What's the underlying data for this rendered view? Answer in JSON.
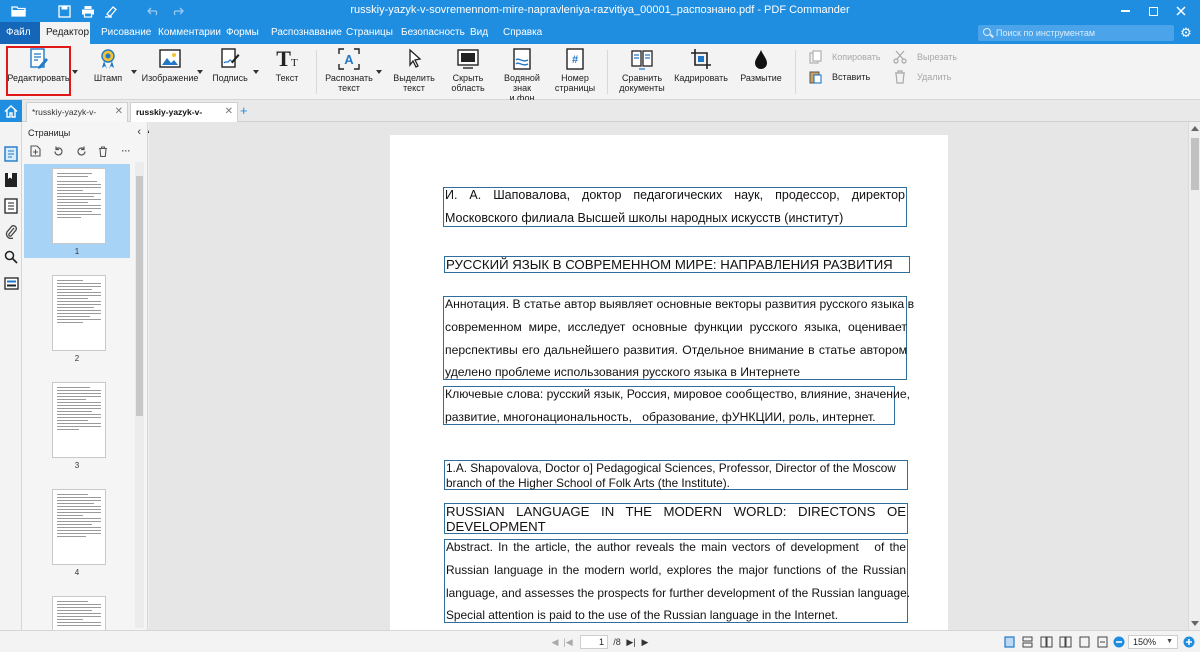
{
  "window": {
    "title": "russkiy-yazyk-v-sovremennom-mire-napravleniya-razvitiya_00001_распознано.pdf - PDF Commander"
  },
  "quick_access": [
    "open-folder-icon",
    "save-icon",
    "print-icon",
    "brush-icon",
    "undo-icon",
    "redo-icon"
  ],
  "menu": {
    "file": "Файл",
    "items": [
      "Редактор",
      "Рисование",
      "Комментарии",
      "Формы",
      "Распознавание",
      "Страницы",
      "Безопасность",
      "Вид",
      "Справка"
    ],
    "active_index": 0,
    "search_placeholder": "Поиск по инструментам"
  },
  "ribbon": {
    "edit": "Редактировать",
    "stamp": "Штамп",
    "image": "Изображение",
    "signature": "Подпись",
    "text": "Текст",
    "recognize_text": [
      "Распознать",
      "текст"
    ],
    "select_text": [
      "Выделить",
      "текст"
    ],
    "hide_area": [
      "Скрыть",
      "область"
    ],
    "watermark": [
      "Водяной знак",
      "и фон"
    ],
    "page_number": [
      "Номер",
      "страницы"
    ],
    "compare": [
      "Сравнить",
      "документы"
    ],
    "crop": "Кадрировать",
    "blur": "Размытие",
    "copy": "Копировать",
    "paste": "Вставить",
    "cut": "Вырезать",
    "delete": "Удалить"
  },
  "tabs": [
    {
      "label": "*russkiy-yazyk-v-sovrem...",
      "active": false
    },
    {
      "label": "russkiy-yazyk-v-sovreme...",
      "active": true
    }
  ],
  "pages_panel": {
    "title": "Страницы",
    "thumbnails": [
      "1",
      "2",
      "3",
      "4"
    ]
  },
  "document": {
    "author_ru": [
      "И.   А.   Шаповалова,   доктор   педагогических   наук,   продессор,   директор",
      "Московского филиала Высшей школы народных искусств (институт)"
    ],
    "title_ru": "РУССКИЙ ЯЗЫК В СОВРЕМЕННОМ МИРЕ: НАПРАВЛЕНИЯ РАЗВИТИЯ",
    "abstract_ru": [
      "Аннотация. В статье автор выявляет основные векторы развития русского языка в",
      "современном мире, исследует основные функции русского языка, оценивает",
      "перспективы его дальнейшего развития. Отдельное внимание в статье автором",
      "уделено проблеме использования русского языка в Интернете"
    ],
    "keywords_ru": [
      "Ключевые слова: русский язык, Россия, мировое сообщество, влияние, значение,",
      "развитие, многонациональность,   образование, фУНКЦИИ, роль, интернет."
    ],
    "author_en": [
      "1.A. Shapovalova, Doctor o] Pedagogical Sciences, Professor, Director of the Moscow",
      "branch of the Higher School of Folk Arts (the Institute)."
    ],
    "title_en": [
      "RUSSIAN   LANGUAGE   IN   THE   MODERN   WORLD:   DIRECTONS   OE",
      "DEVELOPMENT"
    ],
    "abstract_en": [
      "Abstract. In the article, the author reveals the main vectors of development   of the",
      "Russian language in the modern world, explores the major functions of the Russian",
      "language, and assesses the prospects for further development of the Russian language.",
      "Special attention is paid to the use of the Russian language in the Internet."
    ]
  },
  "statusbar": {
    "current_page": "1",
    "total_pages": "/8",
    "zoom": "150%"
  }
}
